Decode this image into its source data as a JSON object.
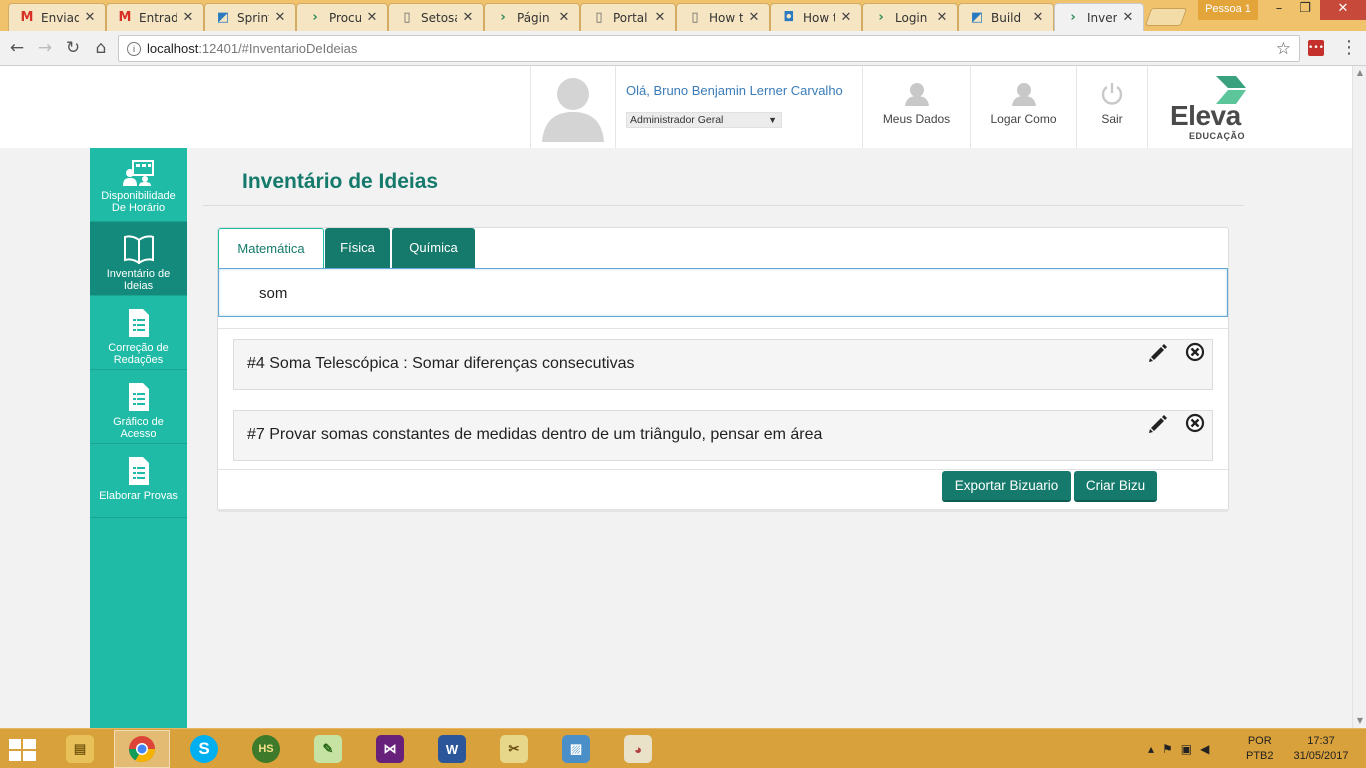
{
  "browser": {
    "tabs": [
      {
        "title": "Enviad",
        "icon": "gmail-icon",
        "active": false
      },
      {
        "title": "Entrad",
        "icon": "gmail-icon",
        "active": false
      },
      {
        "title": "Sprint",
        "icon": "vsts-icon",
        "active": false
      },
      {
        "title": "Procu",
        "icon": "chevron-icon",
        "active": false
      },
      {
        "title": "Setosa",
        "icon": "document-icon",
        "active": false
      },
      {
        "title": "Págin",
        "icon": "chevron-icon",
        "active": false
      },
      {
        "title": "Portal",
        "icon": "document-icon",
        "active": false
      },
      {
        "title": "How t",
        "icon": "document-icon",
        "active": false
      },
      {
        "title": "How t",
        "icon": "chat-icon",
        "active": false
      },
      {
        "title": "Login",
        "icon": "chevron-icon",
        "active": false
      },
      {
        "title": "Build",
        "icon": "vsts-icon",
        "active": false
      },
      {
        "title": "Invent",
        "icon": "chevron-icon",
        "active": true
      }
    ],
    "profile_label": "Pessoa 1",
    "url_host": "localhost",
    "url_path": ":12401/#InventarioDeIdeias"
  },
  "header": {
    "greeting": "Olá, Bruno Benjamin Lerner Carvalho",
    "role": "Administrador Geral",
    "buttons": {
      "meus_dados": "Meus Dados",
      "logar_como": "Logar Como",
      "sair": "Sair"
    },
    "logo": {
      "name": "Eleva",
      "sub": "EDUCAÇÃO"
    }
  },
  "sidebar": {
    "items": [
      {
        "label": "Disponibilidade\nDe Horário",
        "icon": "schedule-icon",
        "active": false
      },
      {
        "label": "Inventário de\nIdeias",
        "icon": "book-icon",
        "active": true
      },
      {
        "label": "Correção de\nRedações",
        "icon": "document-icon",
        "active": false
      },
      {
        "label": "Gráfico de\nAcesso",
        "icon": "document-icon",
        "active": false
      },
      {
        "label": "Elaborar Provas",
        "icon": "document-icon",
        "active": false
      }
    ]
  },
  "main": {
    "title": "Inventário de Ideias",
    "subject_tabs": [
      {
        "label": "Matemática",
        "active": true
      },
      {
        "label": "Física",
        "active": false
      },
      {
        "label": "Química",
        "active": false
      }
    ],
    "search_value": "som",
    "ideas": [
      {
        "text": "#4 Soma Telescópica : Somar diferenças consecutivas"
      },
      {
        "text": "#7 Provar somas constantes de medidas dentro de um triângulo, pensar em área"
      }
    ],
    "buttons": {
      "export": "Exportar Bizuario",
      "create": "Criar Bizu"
    }
  },
  "taskbar": {
    "apps": [
      "file-explorer-icon",
      "chrome-icon",
      "skype-icon",
      "hs-icon",
      "notepad-icon",
      "visual-studio-icon",
      "word-icon",
      "paint-tool-icon",
      "photos-icon",
      "paint-icon"
    ],
    "hs_label": "HS",
    "lang_top": "POR",
    "lang_bottom": "PTB2",
    "time": "17:37",
    "date": "31/05/2017"
  },
  "colors": {
    "accent": "#157a6b",
    "sidebar": "#1fbba6",
    "sidebar_active": "#138a7b",
    "link": "#3a7cb8",
    "taskbar": "#d8a13c"
  }
}
